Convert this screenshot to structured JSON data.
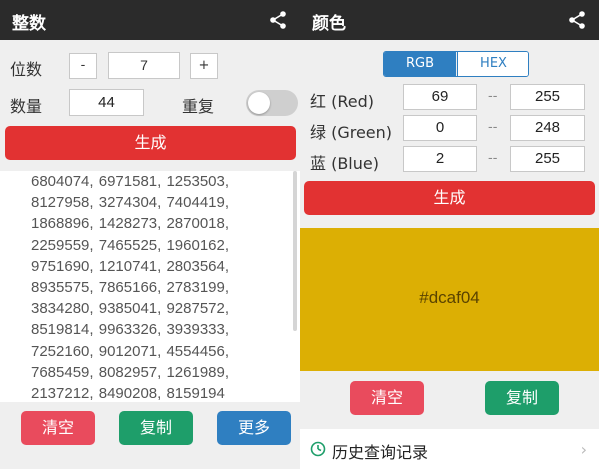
{
  "left": {
    "title": "整数",
    "digits": {
      "label": "位数",
      "minus": "-",
      "value": "7",
      "plus": "+"
    },
    "count": {
      "label": "数量",
      "value": "44"
    },
    "repeat": {
      "label": "重复",
      "on": false
    },
    "generate_label": "生成",
    "result_text": "6804074, 6971581, 1253503, 8127958, 3274304, 7404419, 1868896, 1428273, 2870018, 2259559, 7465525, 1960162, 9751690, 1210741, 2803564, 8935575, 7865166, 2783199, 3834280, 9385041, 9287572, 8519814, 9963326, 3939333, 7252160, 9012071, 4554456, 7685459, 8082957, 1261989, 2137212, 8490208, 8159194",
    "buttons": {
      "clear": "清空",
      "copy": "复制",
      "more": "更多"
    }
  },
  "right": {
    "title": "颜色",
    "mode_tabs": [
      "RGB",
      "HEX"
    ],
    "active_mode": "RGB",
    "channels": [
      {
        "label": "红 (Red)",
        "min": "69",
        "max": "255"
      },
      {
        "label": "绿 (Green)",
        "min": "0",
        "max": "248"
      },
      {
        "label": "蓝 (Blue)",
        "min": "2",
        "max": "255"
      }
    ],
    "range_separator": "--",
    "generate_label": "生成",
    "color_hex": "#dcaf04",
    "buttons": {
      "clear": "清空",
      "copy": "复制"
    },
    "history_label": "历史查询记录"
  },
  "colors": {
    "appbar": "#2b2b2b",
    "red": "#e23232",
    "pink": "#e94b5d",
    "green": "#1e9e6a",
    "blue": "#2f7fc1",
    "swatch": "#dcaf04"
  },
  "icons": {
    "share": "share-icon",
    "clock": "clock-icon",
    "chevron": "chevron-right-icon"
  }
}
